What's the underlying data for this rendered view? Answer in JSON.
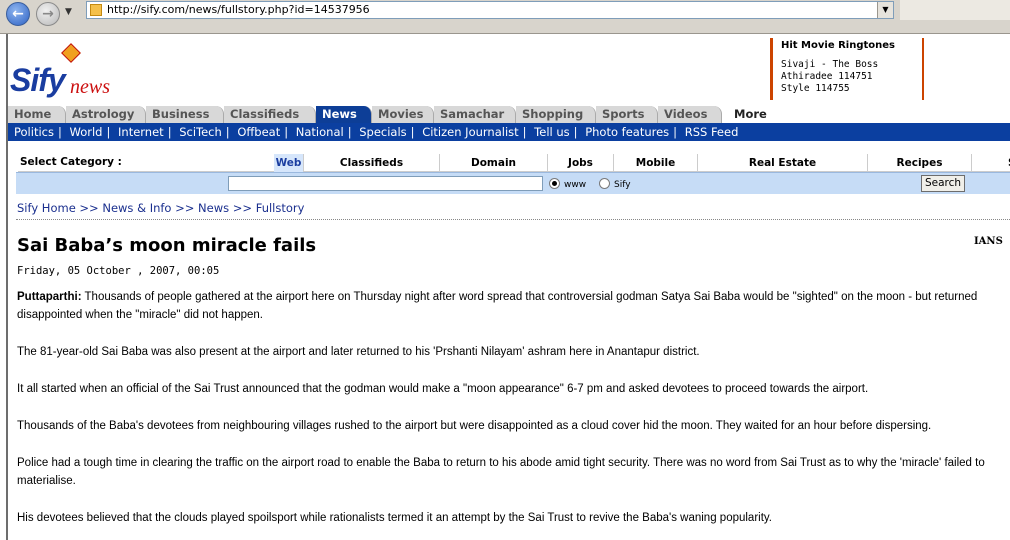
{
  "browser": {
    "url": "http://sify.com/news/fullstory.php?id=14537956"
  },
  "logo": {
    "brand": "Sify",
    "sub": "news"
  },
  "ad": {
    "title": "Hit Movie Ringtones",
    "lines": [
      "Sivaji - The Boss",
      "Athiradee 114751",
      "Style 114755"
    ]
  },
  "tabs": [
    {
      "label": "Home"
    },
    {
      "label": "Astrology"
    },
    {
      "label": "Business"
    },
    {
      "label": "Classifieds"
    },
    {
      "label": "News"
    },
    {
      "label": "Movies"
    },
    {
      "label": "Samachar"
    },
    {
      "label": "Shopping"
    },
    {
      "label": "Sports"
    },
    {
      "label": "Videos"
    },
    {
      "label": "More"
    }
  ],
  "subnav": [
    "Politics",
    "World",
    "Internet",
    "SciTech",
    "Offbeat",
    "National",
    "Specials",
    "Citizen Journalist",
    "Tell us",
    "Photo features",
    "RSS Feed"
  ],
  "search": {
    "category_label": "Select Category :",
    "categories": [
      "Web",
      "Classifieds",
      "Domain",
      "Jobs",
      "Mobile",
      "Real Estate",
      "Recipes",
      "S"
    ],
    "radio_www": "www",
    "radio_sify": "Sify",
    "button": "Search"
  },
  "breadcrumb": "Sify Home >> News & Info >> News >> Fullstory",
  "article": {
    "headline": "Sai Baba’s moon miracle fails",
    "source": "IANS",
    "date": "Friday, 05 October , 2007, 00:05",
    "dateline": "Puttaparthi:",
    "p1": " Thousands of people gathered at the airport here on Thursday night after word spread that controversial godman Satya Sai Baba would be \"sighted\" on the moon - but returned disappointed when the \"miracle\" did not happen.",
    "p2": "The 81-year-old Sai Baba was also present at the airport and later returned to his 'Prshanti Nilayam' ashram here in Anantapur district.",
    "p3": "It all started when an official of the Sai Trust announced that the godman would make a \"moon appearance\" 6-7 pm and asked devotees to proceed towards the airport.",
    "p4": "Thousands of the Baba's devotees from neighbouring villages rushed to the airport but were disappointed as a cloud cover hid the moon. They waited for an hour before dispersing.",
    "p5": "Police had a tough time in clearing the traffic on the airport road to enable the Baba to return to his abode amid tight security. There was no word from Sai Trust as to why the 'miracle' failed to materialise.",
    "p6": "His devotees believed that the clouds played spoilsport while rationalists termed it an attempt by the Sai Trust to revive the Baba's waning popularity."
  }
}
